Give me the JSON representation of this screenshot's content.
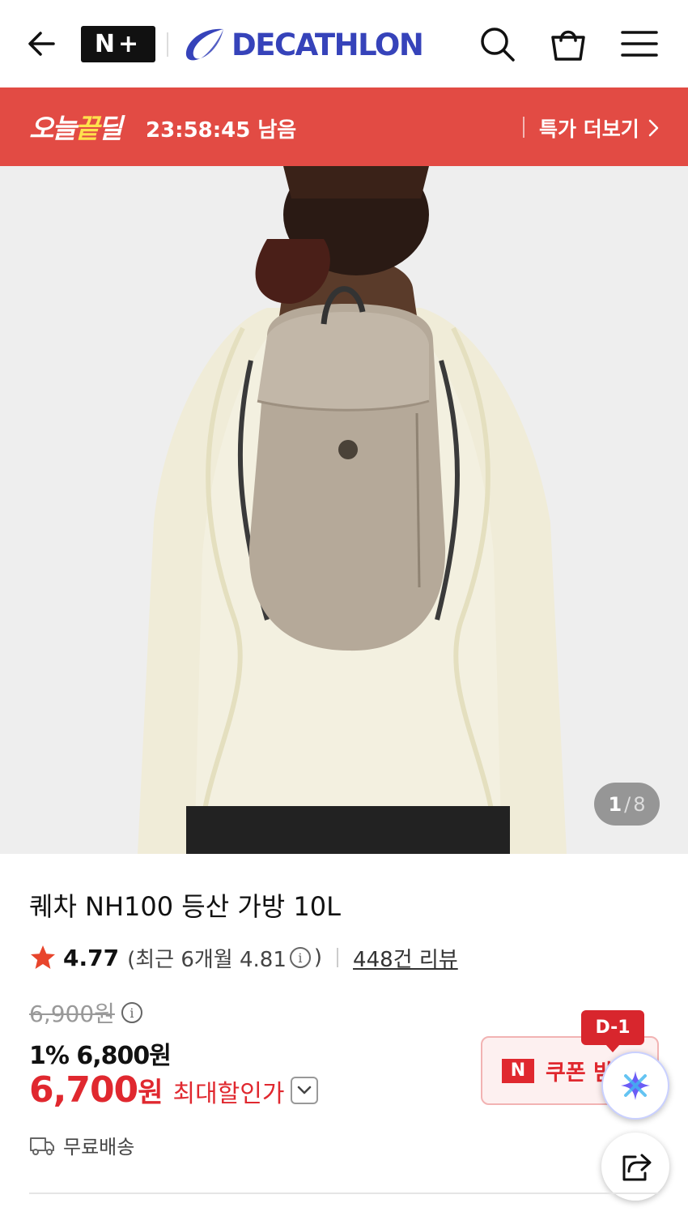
{
  "header": {
    "nplus_label": "N+",
    "brand_name": "DECATHLON"
  },
  "deal": {
    "logo_text": "오늘끝딜",
    "logo_highlight": "끝",
    "timer": "23:58:45 남음",
    "more_label": "특가 더보기"
  },
  "image": {
    "counter_current": "1",
    "counter_sep": "/",
    "counter_total": "8"
  },
  "product": {
    "title": "퀘차 NH100 등산 가방 10L",
    "rating": "4.77",
    "recent_rating": "(최근 6개월 4.81",
    "recent_close": ")",
    "review_count": "448건 리뷰",
    "original_price": "6,900원",
    "sale_line": "1% 6,800원",
    "max_price": "6,700",
    "max_won": "원",
    "max_label": "최대할인가",
    "shipping": "무료배송"
  },
  "coupon": {
    "dday": "D-1",
    "n_label": "N",
    "label": "쿠폰 받기"
  },
  "colors": {
    "deal_red": "#e24b44",
    "price_red": "#e0282f",
    "brand_blue": "#3643ba",
    "highlight_yellow": "#ffe14d"
  },
  "icons": [
    "back-arrow-icon",
    "search-icon",
    "shopping-bag-icon",
    "menu-icon",
    "chevron-right-icon",
    "star-icon",
    "info-icon",
    "chevron-down-icon",
    "truck-icon",
    "ai-sparkle-icon",
    "share-icon"
  ]
}
